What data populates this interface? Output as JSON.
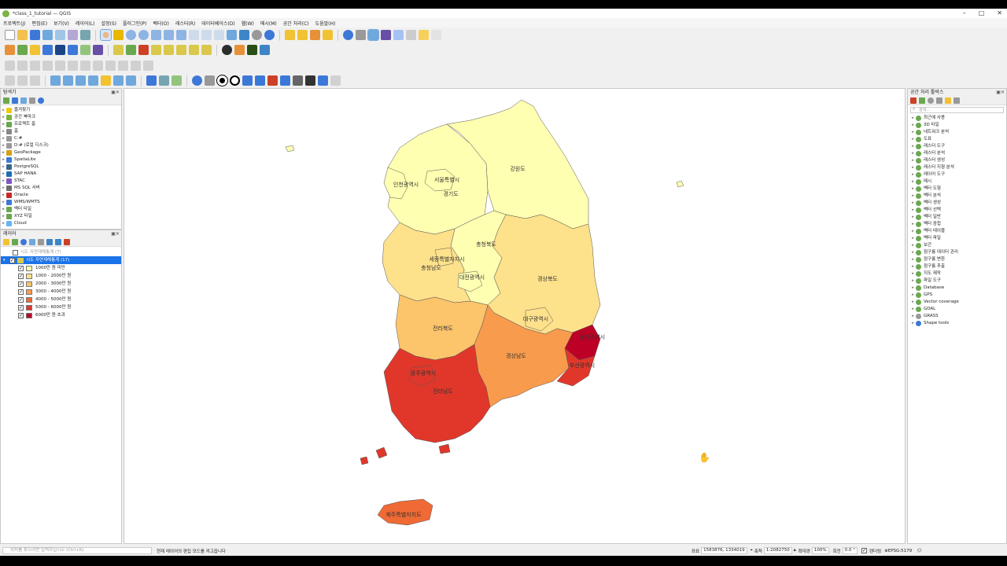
{
  "window": {
    "title": "*class_1_tutorial — QGIS",
    "controls": [
      "–",
      "□",
      "✕"
    ]
  },
  "menubar": [
    "프로젝트(J)",
    "편집(E)",
    "보기(V)",
    "레이어(L)",
    "설정(S)",
    "플러그인(P)",
    "벡터(O)",
    "래스터(R)",
    "데이터베이스(D)",
    "웹(W)",
    "메시(M)",
    "공간 처리(C)",
    "도움말(H)"
  ],
  "browser_panel": {
    "title": "탐색기",
    "items": [
      {
        "label": "즐겨찾기",
        "icon": "star-icon",
        "color": "#f2c811"
      },
      {
        "label": "공간 북마크",
        "icon": "bookmark-icon",
        "color": "#7cb342"
      },
      {
        "label": "프로젝트 홈",
        "icon": "folder-icon",
        "color": "#6aa84f"
      },
      {
        "label": "홈",
        "icon": "home-icon",
        "color": "#888888"
      },
      {
        "label": "C:#",
        "icon": "drive-icon",
        "color": "#999999"
      },
      {
        "label": "D:# (로컬 디스크)",
        "icon": "drive-icon",
        "color": "#999999"
      },
      {
        "label": "GeoPackage",
        "icon": "geopackage-icon",
        "color": "#d4a017"
      },
      {
        "label": "SpatiaLite",
        "icon": "spatialite-icon",
        "color": "#3c78d8"
      },
      {
        "label": "PostgreSQL",
        "icon": "postgresql-icon",
        "color": "#336791"
      },
      {
        "label": "SAP HANA",
        "icon": "sap-icon",
        "color": "#1c6fb5"
      },
      {
        "label": "STAC",
        "icon": "stac-icon",
        "color": "#7e57c2"
      },
      {
        "label": "MS SQL 서버",
        "icon": "mssql-icon",
        "color": "#6d6d6d"
      },
      {
        "label": "Oracle",
        "icon": "oracle-icon",
        "color": "#c62828"
      },
      {
        "label": "WMS/WMTS",
        "icon": "wms-icon",
        "color": "#3c78d8"
      },
      {
        "label": "벡터 타일",
        "icon": "vector-tile-icon",
        "color": "#6aa84f"
      },
      {
        "label": "XYZ 타일",
        "icon": "xyz-tile-icon",
        "color": "#6aa84f"
      },
      {
        "label": "Cloud",
        "icon": "cloud-icon",
        "color": "#64b5f6"
      }
    ]
  },
  "layers_panel": {
    "title": "레이어",
    "layers": [
      {
        "label": "시도 자연재해통계 (7)",
        "checked": false,
        "muted": true
      },
      {
        "label": "시도 자연재해통계 (17)",
        "checked": true,
        "selected": true
      }
    ],
    "legend": [
      {
        "label": "1000만 원 미만",
        "color": "#ffffb2"
      },
      {
        "label": "1000 - 2000만 원",
        "color": "#fee18b"
      },
      {
        "label": "2000 - 3000만 원",
        "color": "#fcc46b"
      },
      {
        "label": "3000 - 4000만 원",
        "color": "#f89b4d"
      },
      {
        "label": "4000 - 5000만 원",
        "color": "#ef6a34"
      },
      {
        "label": "5000 - 6000만 원",
        "color": "#e0372a"
      },
      {
        "label": "6000만 원 초과",
        "color": "#bd0026"
      }
    ]
  },
  "toolbox_panel": {
    "title": "공간 처리 툴박스",
    "search_placeholder": "검색...",
    "items": [
      "최근에 사용",
      "3D 타일",
      "네트워크 분석",
      "도표",
      "래스터 도구",
      "래스터 분석",
      "래스터 생성",
      "래스터 지형 분석",
      "레이어 도구",
      "메시",
      "벡터 도형",
      "벡터 분석",
      "벡터 생성",
      "벡터 선택",
      "벡터 일반",
      "벡터 중첩",
      "벡터 테이블",
      "벡터 파일",
      "보간",
      "점구름 데이터 관리",
      "점구름 변환",
      "점구름 추출",
      "지도 제작",
      "파일 도구",
      "Database",
      "GPS",
      "Vector coverage",
      "GDAL",
      "GRASS",
      "Shape tools"
    ]
  },
  "map": {
    "regions": [
      {
        "name": "강원도",
        "color": "#ffffb2"
      },
      {
        "name": "서울특별시",
        "color": "#ffffb2"
      },
      {
        "name": "인천광역시",
        "color": "#ffffb2"
      },
      {
        "name": "경기도",
        "color": "#ffffb2"
      },
      {
        "name": "충청북도",
        "color": "#ffffb2"
      },
      {
        "name": "세종특별자치시",
        "color": "#fee18b"
      },
      {
        "name": "충청남도",
        "color": "#fee18b"
      },
      {
        "name": "대전광역시",
        "color": "#ffffb2"
      },
      {
        "name": "경상북도",
        "color": "#fee18b"
      },
      {
        "name": "대구광역시",
        "color": "#fee18b"
      },
      {
        "name": "전라북도",
        "color": "#fcc46b"
      },
      {
        "name": "울산광역시",
        "color": "#bd0026"
      },
      {
        "name": "경상남도",
        "color": "#f89b4d"
      },
      {
        "name": "부산광역시",
        "color": "#e0372a"
      },
      {
        "name": "광주광역시",
        "color": "#e0372a"
      },
      {
        "name": "전라남도",
        "color": "#e0372a"
      },
      {
        "name": "제주특별자치도",
        "color": "#ef6a34"
      }
    ]
  },
  "statusbar": {
    "locator_placeholder": "위치를 찾으려면 입력하십시오 (Ctrl+K)",
    "message": "현재 레이어의 편집 모드를 켜고끕니다",
    "coord_label": "좌표",
    "coord_value": "1583876, 1334019",
    "scale_label": "축척",
    "scale_value": "1:2082750",
    "magnifier_label": "확대경",
    "magnifier_value": "100%",
    "rotation_label": "회전",
    "rotation_value": "0.0 °",
    "render_label": "렌더링",
    "crs": "EPSG:5179"
  }
}
